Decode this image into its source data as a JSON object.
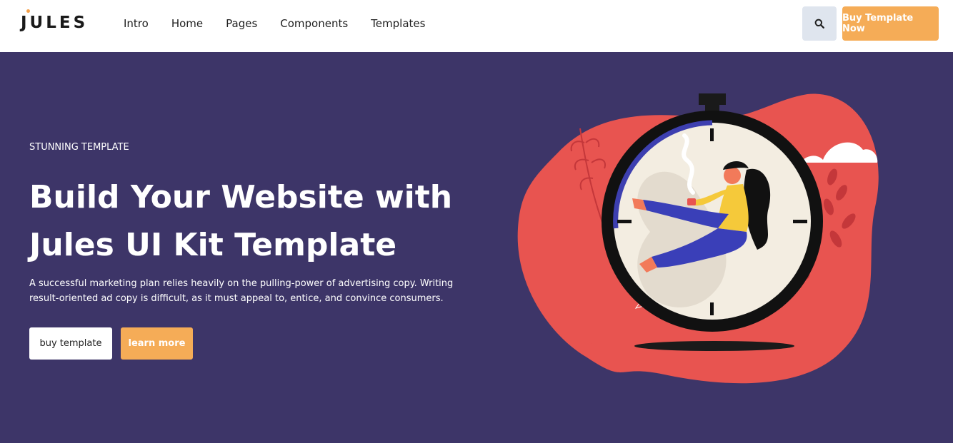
{
  "header": {
    "logo": "JULES",
    "nav": [
      "Intro",
      "Home",
      "Pages",
      "Components",
      "Templates"
    ],
    "buy_label": "Buy Template Now"
  },
  "hero": {
    "eyebrow": "STUNNING TEMPLATE",
    "headline_line1": "Build Your Website with",
    "headline_line2": "Jules UI Kit Template",
    "lede": "A successful marketing plan relies heavily on the pulling-power of advertising copy. Writing result-oriented ad copy is difficult, as it must appeal to, entice, and convince consumers.",
    "primary_button": "buy template",
    "secondary_button": "learn more"
  },
  "icons": {
    "search": "search-icon"
  },
  "colors": {
    "background": "#3d3568",
    "accent": "#f5ac57",
    "blob": "#e85450",
    "search_button": "#dfe5ee"
  }
}
